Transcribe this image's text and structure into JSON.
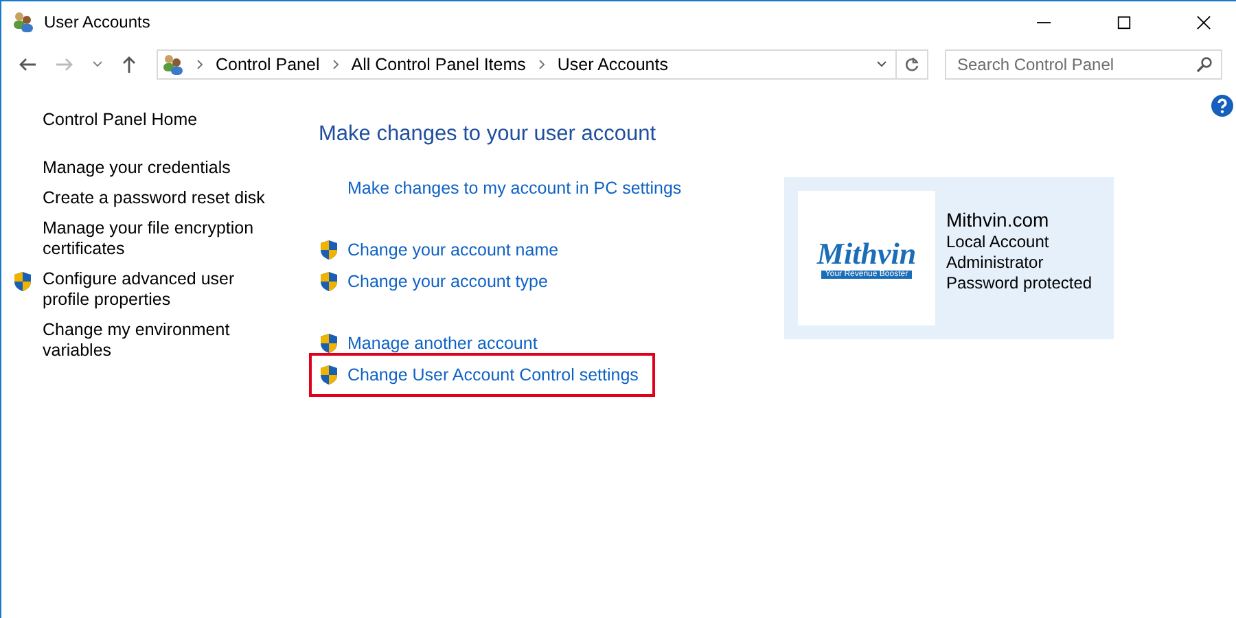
{
  "window": {
    "title": "User Accounts"
  },
  "address_bar": {
    "path": [
      "Control Panel",
      "All Control Panel Items",
      "User Accounts"
    ]
  },
  "search": {
    "placeholder": "Search Control Panel"
  },
  "sidebar": {
    "items": [
      {
        "label": "Control Panel Home",
        "kind": "plain"
      },
      {
        "label": "Manage your credentials",
        "kind": "plain"
      },
      {
        "label": "Create a password reset disk",
        "kind": "plain"
      },
      {
        "label": "Manage your file encryption certificates",
        "kind": "plain"
      },
      {
        "label": "Configure advanced user profile properties",
        "kind": "shield"
      },
      {
        "label": "Change my environment variables",
        "kind": "plain"
      }
    ]
  },
  "heading": "Make changes to your user account",
  "links": [
    {
      "label": "Make changes to my account in PC settings",
      "kind": "plain",
      "highlighted": false
    },
    {
      "label": "Change your account name",
      "kind": "shield",
      "highlighted": false
    },
    {
      "label": "Change your account type",
      "kind": "shield",
      "highlighted": false
    },
    {
      "label": "Manage another account",
      "kind": "shield",
      "highlighted": false
    },
    {
      "label": "Change User Account Control settings",
      "kind": "shield",
      "highlighted": true
    }
  ],
  "account": {
    "logo": {
      "name": "Mithvin",
      "tagline": "Your Revenue Booster"
    },
    "name": "Mithvin.com",
    "details": [
      "Local Account",
      "Administrator",
      "Password protected"
    ]
  }
}
